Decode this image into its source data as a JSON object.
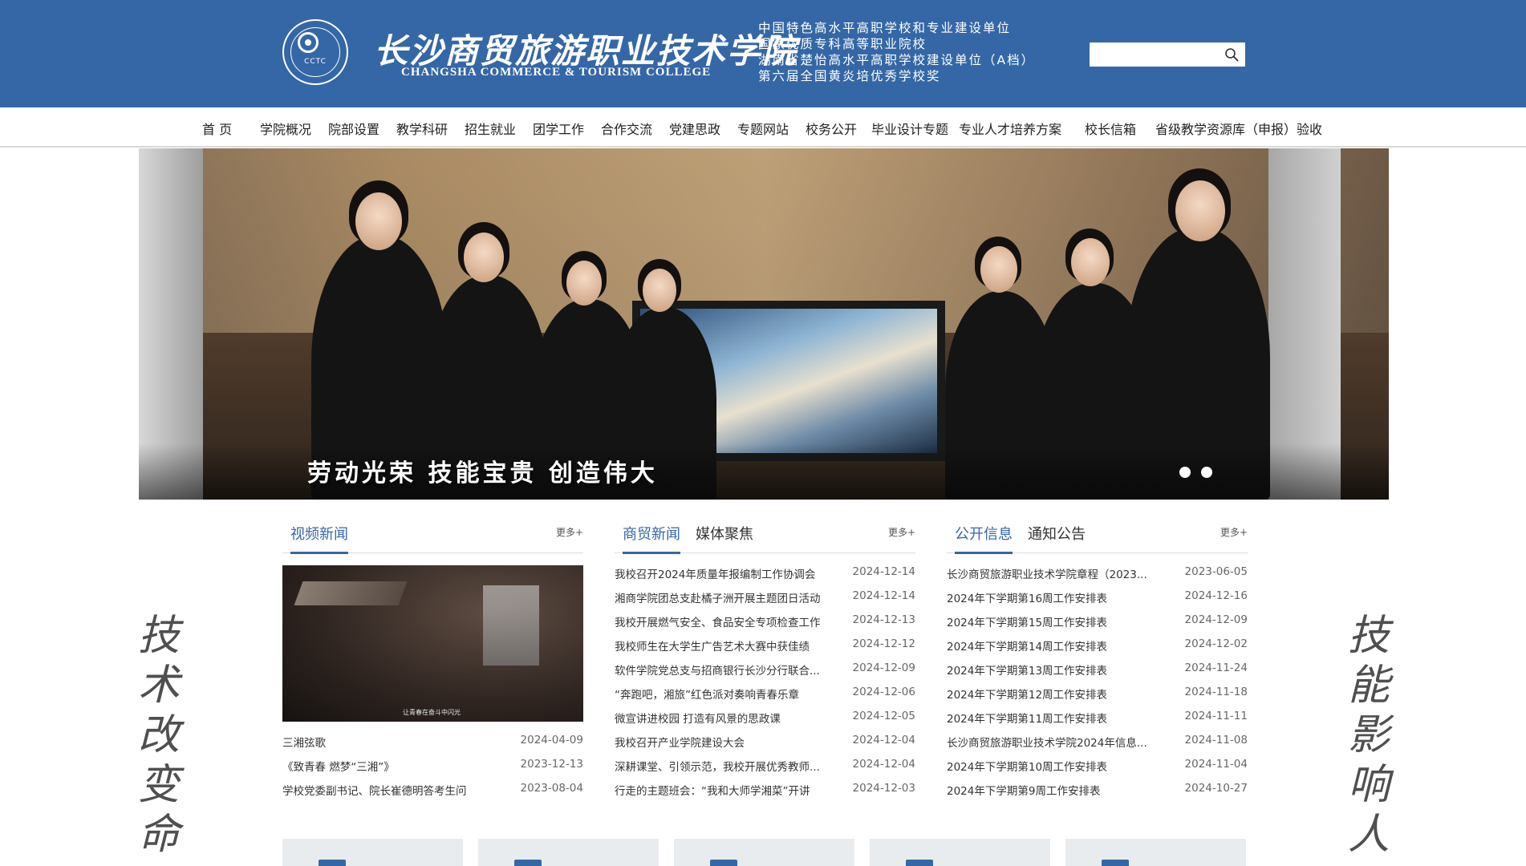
{
  "header": {
    "logo_abbr": "CCTC",
    "college_name_cn": "长沙商贸旅游职业技术学院",
    "college_name_en": "CHANGSHA COMMERCE & TOURISM COLLEGE",
    "honors": [
      "中国特色高水平高职学校和专业建设单位",
      "国家优质专科高等职业院校",
      "湖南省楚怡高水平高职学校建设单位（A档）",
      "第六届全国黄炎培优秀学校奖"
    ],
    "search": {
      "placeholder": "",
      "value": ""
    },
    "brand_color": "#3567a6"
  },
  "nav": {
    "items": [
      "首 页",
      "学院概况",
      "院部设置",
      "教学科研",
      "招生就业",
      "团学工作",
      "合作交流",
      "党建思政",
      "专题网站",
      "校务公开",
      "毕业设计专题",
      "专业人才培养方案",
      "校长信箱",
      "省级教学资源库（申报）验收"
    ]
  },
  "banner": {
    "slogan": "劳动光荣  技能宝贵  创造伟大",
    "slide_count": 2,
    "active_slide": 1
  },
  "side": {
    "left": [
      "技",
      "术",
      "改",
      "变",
      "命"
    ],
    "right": [
      "技",
      "能",
      "影",
      "响",
      "人"
    ]
  },
  "video_news": {
    "tab": "视频新闻",
    "more": "更多+",
    "thumb_caption": "让青春在奋斗中闪光",
    "items": [
      {
        "title": "三湘弦歌",
        "date": "2024-04-09"
      },
      {
        "title": "《致青春 燃梦“三湘”》",
        "date": "2023-12-13"
      },
      {
        "title": "学校党委副书记、院长崔德明答考生问",
        "date": "2023-08-04"
      }
    ]
  },
  "commerce_news": {
    "tabs": [
      "商贸新闻",
      "媒体聚焦"
    ],
    "more": "更多+",
    "items": [
      {
        "title": "我校召开2024年质量年报编制工作协调会",
        "date": "2024-12-14"
      },
      {
        "title": "湘商学院团总支赴橘子洲开展主题团日活动",
        "date": "2024-12-14"
      },
      {
        "title": "我校开展燃气安全、食品安全专项检查工作",
        "date": "2024-12-13"
      },
      {
        "title": "我校师生在大学生广告艺术大赛中获佳绩",
        "date": "2024-12-12"
      },
      {
        "title": "软件学院党总支与招商银行长沙分行联合...",
        "date": "2024-12-09"
      },
      {
        "title": "“奔跑吧，湘旅”红色派对奏响青春乐章",
        "date": "2024-12-06"
      },
      {
        "title": "微宣讲进校园 打造有风景的思政课",
        "date": "2024-12-05"
      },
      {
        "title": "我校召开产业学院建设大会",
        "date": "2024-12-04"
      },
      {
        "title": "深耕课堂、引领示范，我校开展优秀教师...",
        "date": "2024-12-04"
      },
      {
        "title": "行走的主题班会：“我和大师学湘菜”开讲",
        "date": "2024-12-03"
      }
    ]
  },
  "public_info": {
    "tabs": [
      "公开信息",
      "通知公告"
    ],
    "more": "更多+",
    "items": [
      {
        "title": "长沙商贸旅游职业技术学院章程（2023...",
        "date": "2023-06-05"
      },
      {
        "title": "2024年下学期第16周工作安排表",
        "date": "2024-12-16"
      },
      {
        "title": "2024年下学期第15周工作安排表",
        "date": "2024-12-09"
      },
      {
        "title": "2024年下学期第14周工作安排表",
        "date": "2024-12-02"
      },
      {
        "title": "2024年下学期第13周工作安排表",
        "date": "2024-11-24"
      },
      {
        "title": "2024年下学期第12周工作安排表",
        "date": "2024-11-18"
      },
      {
        "title": "2024年下学期第11周工作安排表",
        "date": "2024-11-11"
      },
      {
        "title": "长沙商贸旅游职业技术学院2024年信息...",
        "date": "2024-11-08"
      },
      {
        "title": "2024年下学期第10周工作安排表",
        "date": "2024-11-04"
      },
      {
        "title": "2024年下学期第9周工作安排表",
        "date": "2024-10-27"
      }
    ]
  },
  "quick_links": {
    "icons": [
      "book-icon",
      "library-icon",
      "calendar-icon",
      "user-icon",
      "gear-icon"
    ]
  }
}
